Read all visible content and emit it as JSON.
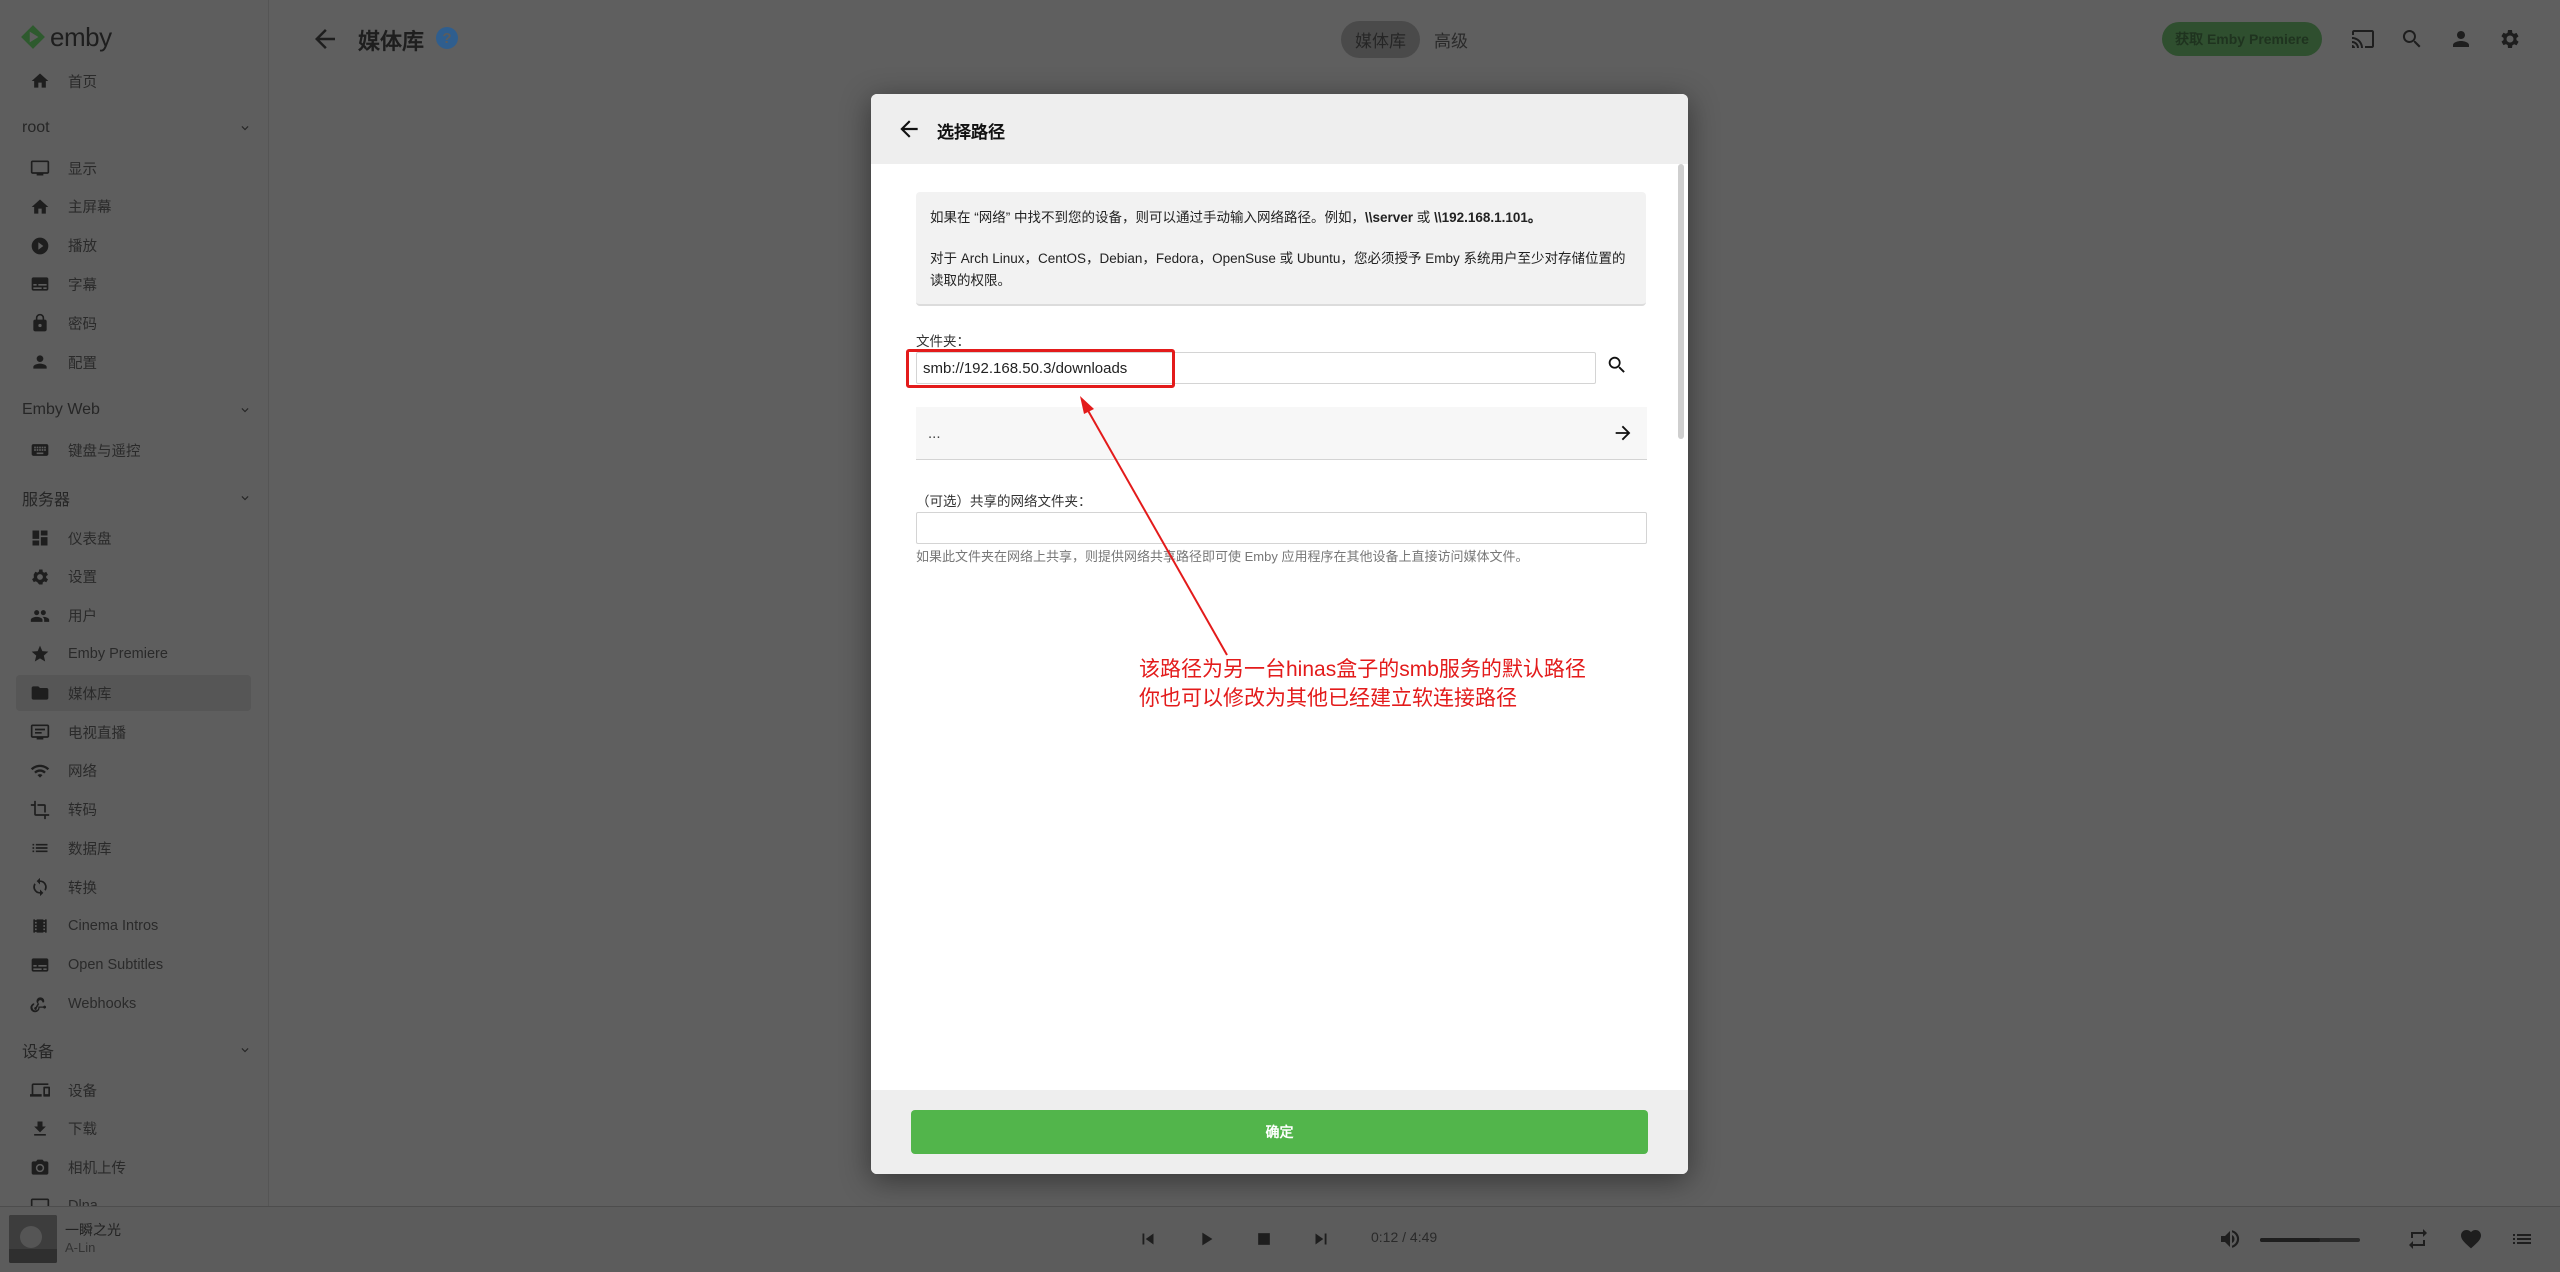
{
  "app": {
    "logo_text": "emby"
  },
  "sidebar": {
    "home_label": "首页",
    "sections": [
      {
        "title": "root",
        "items": [
          {
            "label": "显示",
            "icon": "monitor-icon"
          },
          {
            "label": "主屏幕",
            "icon": "home-icon"
          },
          {
            "label": "播放",
            "icon": "play-circle-icon"
          },
          {
            "label": "字幕",
            "icon": "subtitles-icon"
          },
          {
            "label": "密码",
            "icon": "lock-icon"
          },
          {
            "label": "配置",
            "icon": "person-icon"
          }
        ]
      },
      {
        "title": "Emby Web",
        "items": [
          {
            "label": "键盘与遥控",
            "icon": "keyboard-icon"
          }
        ]
      },
      {
        "title": "服务器",
        "items": [
          {
            "label": "仪表盘",
            "icon": "dashboard-icon"
          },
          {
            "label": "设置",
            "icon": "gear-icon"
          },
          {
            "label": "用户",
            "icon": "users-icon"
          },
          {
            "label": "Emby Premiere",
            "icon": "star-icon"
          },
          {
            "label": "媒体库",
            "icon": "folder-icon",
            "active": true
          },
          {
            "label": "电视直播",
            "icon": "tv-guide-icon"
          },
          {
            "label": "网络",
            "icon": "wifi-icon"
          },
          {
            "label": "转码",
            "icon": "crop-icon"
          },
          {
            "label": "数据库",
            "icon": "list-icon"
          },
          {
            "label": "转换",
            "icon": "sync-icon"
          },
          {
            "label": "Cinema Intros",
            "icon": "film-icon"
          },
          {
            "label": "Open Subtitles",
            "icon": "subtitles-icon"
          },
          {
            "label": "Webhooks",
            "icon": "webhook-icon"
          }
        ]
      },
      {
        "title": "设备",
        "items": [
          {
            "label": "设备",
            "icon": "devices-icon"
          },
          {
            "label": "下载",
            "icon": "download-icon"
          },
          {
            "label": "相机上传",
            "icon": "camera-icon"
          },
          {
            "label": "Dlna",
            "icon": "dlna-icon"
          }
        ]
      }
    ]
  },
  "header": {
    "title": "媒体库",
    "help": "?",
    "tabs": [
      {
        "label": "媒体库",
        "active": true
      },
      {
        "label": "高级",
        "active": false
      }
    ],
    "premiere_button": "获取 Emby Premiere"
  },
  "dialog": {
    "title": "选择路径",
    "info_line1_prefix": "如果在 “网络” 中找不到您的设备，则可以通过手动输入网络路径。例如，",
    "info_line1_example1": "\\\\server",
    "info_line1_or": " 或 ",
    "info_line1_example2": "\\\\192.168.1.101。",
    "info_line2": "对于 Arch Linux，CentOS，Debian，Fedora，OpenSuse 或 Ubuntu，您必须授予 Emby 系统用户至少对存储位置的读取的权限。",
    "folder_label": "文件夹：",
    "folder_value": "smb://192.168.50.3/downloads",
    "parent_dir": "...",
    "share_label": "（可选）共享的网络文件夹：",
    "share_value": "",
    "share_hint": "如果此文件夹在网络上共享，则提供网络共享路径即可使 Emby 应用程序在其他设备上直接访问媒体文件。",
    "ok_button": "确定"
  },
  "annotation": {
    "line1": "该路径为另一台hinas盒子的smb服务的默认路径",
    "line2": "你也可以修改为其他已经建立软连接路径",
    "color": "#e31b1b"
  },
  "player": {
    "title": "一瞬之光",
    "artist": "A-Lin",
    "time": "0:12 / 4:49",
    "volume": 0.6
  }
}
